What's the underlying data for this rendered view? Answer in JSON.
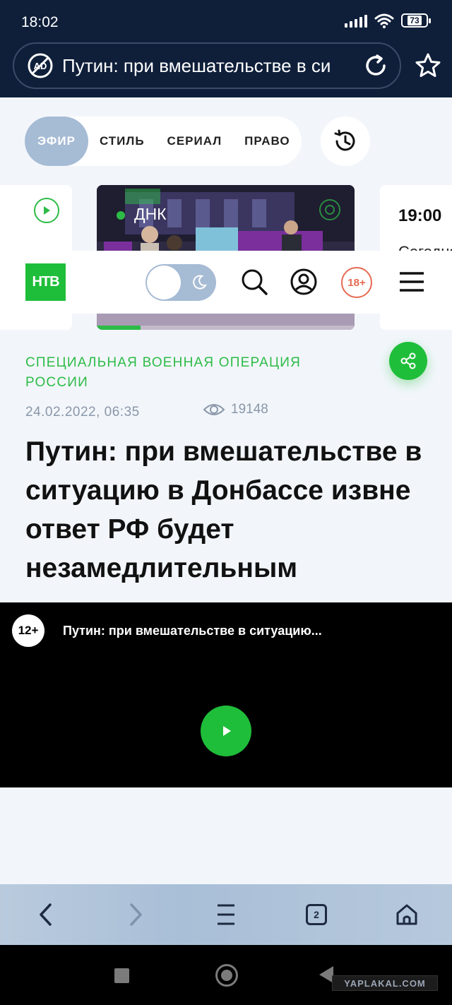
{
  "status_bar": {
    "time": "18:02",
    "battery": "73"
  },
  "url_bar": {
    "text": "Путин: при вмешательстве в си"
  },
  "tabs": [
    {
      "label": "ЭФИР",
      "active": true
    },
    {
      "label": "СТИЛЬ",
      "active": false
    },
    {
      "label": "СЕРИАЛ",
      "active": false
    },
    {
      "label": "ПРАВО",
      "active": false
    }
  ],
  "carousel": {
    "live_title": "ДНК",
    "live_progress": 0.17,
    "next_time": "19:00",
    "next_desc": "Сегодня"
  },
  "header": {
    "logo": "НТВ",
    "age_rating": "18+"
  },
  "article": {
    "category": "СПЕЦИАЛЬНАЯ ВОЕННАЯ ОПЕРАЦИЯ РОССИИ",
    "date": "24.02.2022, 06:35",
    "views": "19148",
    "headline": "Путин: при вмешательстве в ситуацию в Донбассе извне ответ РФ будет незамедлительным"
  },
  "player": {
    "age_rating": "12+",
    "title": "Путин: при вмешательстве в ситуацию..."
  },
  "browser_nav": {
    "tabs_count": "2"
  },
  "watermark": "YAPLAKAL.COM",
  "colors": {
    "accent_green": "#1fbe3a",
    "top_bar": "#0f1f3a",
    "tab_active": "#a6bbd4",
    "age_badge": "#e56a52"
  }
}
